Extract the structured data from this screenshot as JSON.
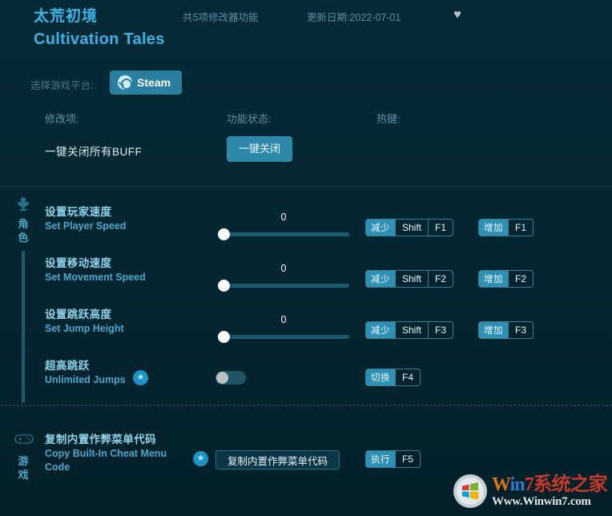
{
  "header": {
    "title_cn": "太荒初境",
    "title_en": "Cultivation Tales",
    "feature_count": "共5项修改器功能",
    "update_date": "更新日期:2022-07-01",
    "favorite_icon": "heart-icon"
  },
  "platform": {
    "label": "选择游戏平台:",
    "selected": "Steam",
    "icon": "steam-icon"
  },
  "columns": {
    "mod": "修改项:",
    "state": "功能状态:",
    "hotkey": "热键:"
  },
  "global": {
    "label": "一键关闭所有BUFF",
    "button": "一键关闭"
  },
  "sections": [
    {
      "id": "character",
      "label": "角色",
      "icon": "character-icon",
      "rows": [
        {
          "name_cn": "设置玩家速度",
          "name_en": "Set Player Speed",
          "control": "slider",
          "value": "0",
          "star": false,
          "hotkeys": [
            {
              "action": "减少",
              "keys": [
                "Shift",
                "F1"
              ]
            },
            {
              "action": "增加",
              "keys": [
                "F1"
              ]
            }
          ]
        },
        {
          "name_cn": "设置移动速度",
          "name_en": "Set Movement Speed",
          "control": "slider",
          "value": "0",
          "star": false,
          "hotkeys": [
            {
              "action": "减少",
              "keys": [
                "Shift",
                "F2"
              ]
            },
            {
              "action": "增加",
              "keys": [
                "F2"
              ]
            }
          ]
        },
        {
          "name_cn": "设置跳跃高度",
          "name_en": "Set Jump Height",
          "control": "slider",
          "value": "0",
          "star": false,
          "hotkeys": [
            {
              "action": "减少",
              "keys": [
                "Shift",
                "F3"
              ]
            },
            {
              "action": "增加",
              "keys": [
                "F3"
              ]
            }
          ]
        },
        {
          "name_cn": "超高跳跃",
          "name_en": "Unlimited Jumps",
          "control": "toggle",
          "value": "off",
          "star": true,
          "star_icon": "star-icon",
          "hotkeys": [
            {
              "action": "切换",
              "keys": [
                "F4"
              ]
            }
          ]
        }
      ]
    },
    {
      "id": "game",
      "label": "游戏",
      "icon": "gamepad-icon",
      "rows": [
        {
          "name_cn": "复制内置作弊菜单代码",
          "name_en": "Copy Built-In Cheat Menu Code",
          "control": "button",
          "button_label": "复制内置作弊菜单代码",
          "star": true,
          "star_icon": "star-icon",
          "hotkeys": [
            {
              "action": "执行",
              "keys": [
                "F5"
              ]
            }
          ]
        }
      ]
    }
  ],
  "watermark": {
    "brand_w": "W",
    "brand_in": "in",
    "brand_7": "7",
    "brand_cn": "系统之家",
    "url": "Www.Winwin7.com",
    "logo_icon": "windows-logo-icon"
  },
  "colors": {
    "background": "#04252f",
    "accent": "#2e90b4",
    "title": "#3fb3e8",
    "name_cn": "#8fd3ea",
    "name_en": "#4ca7cd",
    "muted": "#5d8c9c"
  }
}
